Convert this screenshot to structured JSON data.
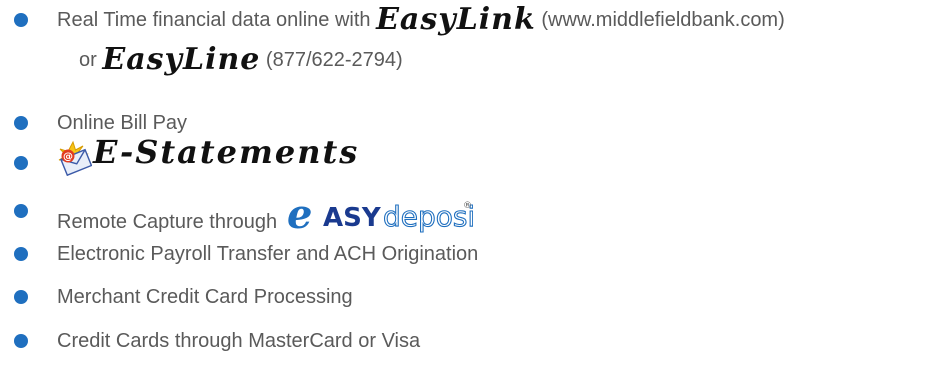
{
  "items": [
    {
      "pre": "Real Time financial data online with ",
      "brand": "EasyLink",
      "post": " (www.middlefieldbank.com)",
      "line2_pre": "or ",
      "line2_brand": "EasyLine",
      "line2_post": " (877/622-2794)"
    },
    {
      "text": "Online Bill Pay"
    },
    {
      "brand": "E-Statements",
      "icon": "envelope-at-icon"
    },
    {
      "text": "Remote Capture through ",
      "logo": {
        "e": "e",
        "asy": "ASY",
        "deposit": "deposit",
        "reg": "®"
      }
    },
    {
      "text": "Electronic Payroll Transfer and ACH Origination"
    },
    {
      "text": "Merchant Credit Card Processing"
    },
    {
      "text": "Credit Cards through MasterCard or Visa"
    }
  ],
  "colors": {
    "bullet": "#1f6fbf",
    "text": "#5a5a5a",
    "logo_blue": "#1f6fbf",
    "logo_navy": "#1a3a8f"
  }
}
